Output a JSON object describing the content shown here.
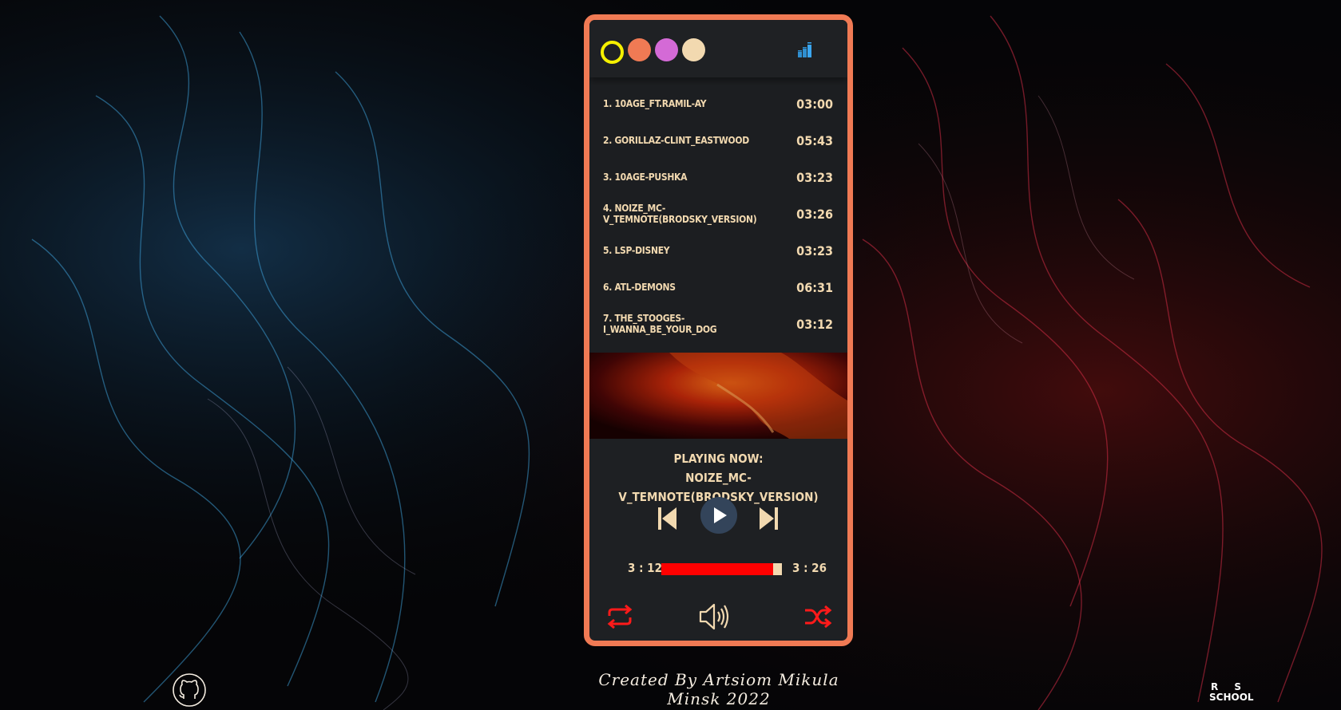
{
  "theme": {
    "frame_color": "#f07a54",
    "panel_color": "#1e2023",
    "text_color": "#f2d9b0",
    "accent_red": "#ff0000",
    "dots": [
      "#f5f000",
      "#f07a54",
      "#d46ad6",
      "#f2d9b0"
    ]
  },
  "header": {
    "eq_icon": "equalizer-icon"
  },
  "playlist": [
    {
      "name": "1. 10AGE_FT.RAMIL-AY",
      "time": "03:00"
    },
    {
      "name": "2. GORILLAZ-CLINT_EASTWOOD",
      "time": "05:43"
    },
    {
      "name": "3. 10AGE-PUSHKA",
      "time": "03:23"
    },
    {
      "name": "4. NOIZE_MC-V_TEMNOTE(BRODSKY_VERSION)",
      "time": "03:26"
    },
    {
      "name": "5. LSP-DISNEY",
      "time": "03:23"
    },
    {
      "name": "6. ATL-DEMONS",
      "time": "06:31"
    },
    {
      "name": "7. THE_STOOGES-I_WANNA_BE_YOUR_DOG",
      "time": "03:12"
    }
  ],
  "now_playing": {
    "label": "PLAYING NOW:",
    "title": "NOIZE_MC-V_TEMNOTE(BRODSKY_VERSION)"
  },
  "progress": {
    "current": "3 : 12",
    "total": "3 : 26",
    "fraction": 0.93
  },
  "controls": {
    "prev_icon": "skip-previous-icon",
    "play_icon": "play-icon",
    "next_icon": "skip-next-icon",
    "repeat_icon": "repeat-icon",
    "volume_icon": "volume-icon",
    "shuffle_icon": "shuffle-icon"
  },
  "footer": {
    "line1": "Created By Artsiom Mikula",
    "line2": "Minsk 2022",
    "github_icon": "github-icon",
    "rs_logo": [
      "R S",
      "SCHOOL"
    ]
  }
}
